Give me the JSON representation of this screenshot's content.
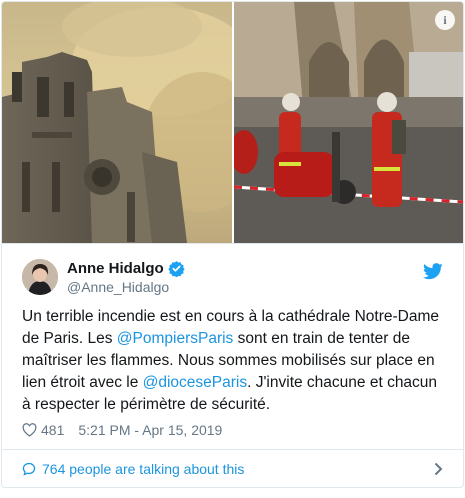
{
  "author": {
    "name": "Anne Hidalgo",
    "handle": "@Anne_Hidalgo"
  },
  "tweet": {
    "p1": "Un terrible incendie est en cours à la cathédrale Notre-Dame de Paris. Les ",
    "m1": "@PompiersParis",
    "p2": " sont en train de tenter de maîtriser les flammes. Nous sommes mobilisés sur place en lien étroit avec le ",
    "m2": "@dioceseParis",
    "p3": ". J'invite chacune et chacun à respecter le périmètre de sécurité."
  },
  "meta": {
    "likes": "481",
    "timestamp": "5:21 PM - Apr 15, 2019"
  },
  "footer": {
    "talking": "764 people are talking about this"
  },
  "info_label": "i",
  "colors": {
    "link": "#1b95e0",
    "muted": "#657786",
    "border": "#e1e8ed",
    "verified": "#1da1f2"
  },
  "icons": [
    "info-icon",
    "verified-icon",
    "twitter-bird-icon",
    "heart-icon",
    "speech-bubble-icon",
    "chevron-right-icon"
  ]
}
